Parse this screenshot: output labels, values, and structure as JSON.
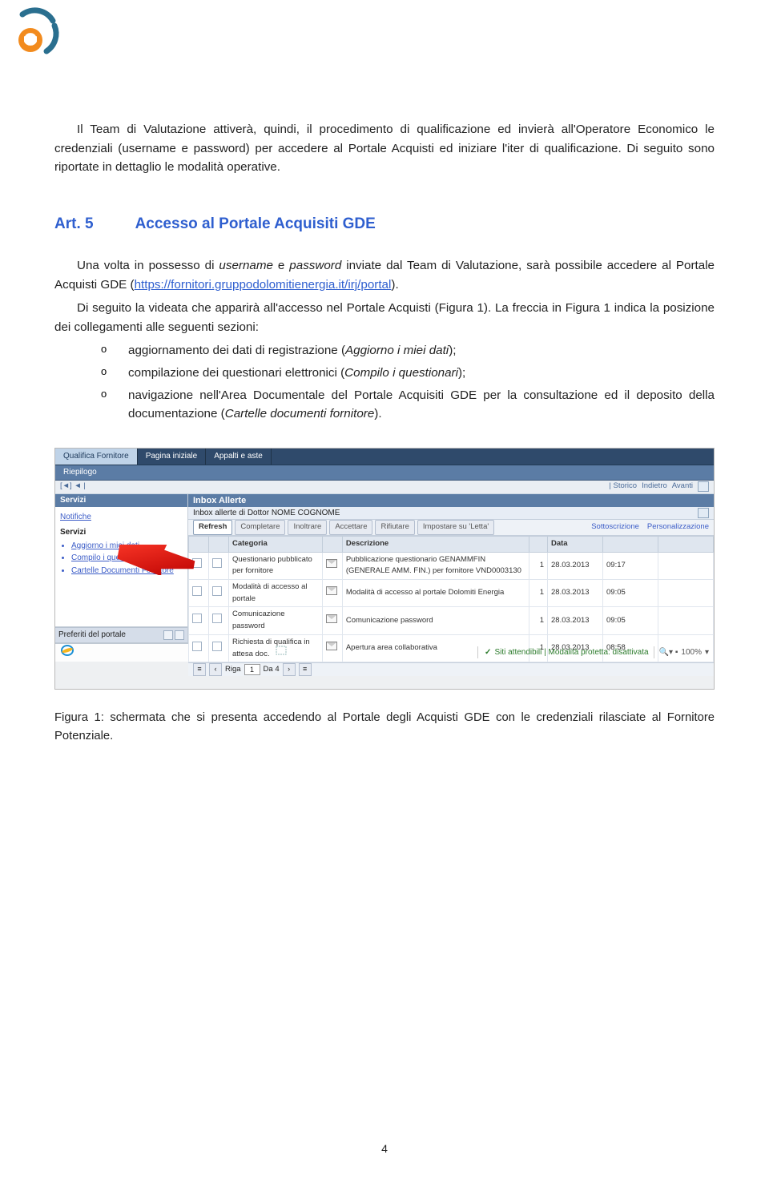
{
  "para1": "Il Team di Valutazione attiverà, quindi, il procedimento di qualificazione ed invierà all'Operatore Economico le credenziali (username e password) per accedere al Portale Acquisti ed iniziare l'iter di qualificazione. Di seguito sono riportate in dettaglio le modalità operative.",
  "article": {
    "num": "Art. 5",
    "title": "Accesso al Portale Acquisiti GDE"
  },
  "para2a": "Una volta in possesso di ",
  "para2b": "username",
  "para2c": " e ",
  "para2d": "password",
  "para2e": " inviate dal Team di Valutazione, sarà possibile accedere al Portale Acquisti GDE (",
  "link": "https://fornitori.gruppodolomitienergia.it/irj/portal",
  "para2f": ").",
  "para3": "Di seguito la videata che apparirà all'accesso nel Portale Acquisti (Figura 1). La freccia in Figura 1 indica la posizione dei collegamenti alle seguenti sezioni:",
  "bullets": [
    {
      "pre": "aggiornamento dei dati di registrazione (",
      "it": "Aggiorno i miei dati",
      "post": ");"
    },
    {
      "pre": "compilazione dei questionari elettronici (",
      "it": "Compilo i questionari",
      "post": ");"
    },
    {
      "pre": "navigazione nell'Area Documentale del Portale Acquisiti GDE per la consultazione ed il deposito della documentazione (",
      "it": "Cartelle documenti fornitore",
      "post": ")."
    }
  ],
  "shot": {
    "tabs": [
      "Qualifica Fornitore",
      "Pagina iniziale",
      "Appalti e aste"
    ],
    "riepilogo": "Riepilogo",
    "hist": {
      "left": "[◄] ◄ |",
      "items": [
        "| Storico",
        "Indietro",
        "Avanti"
      ]
    },
    "sidebar": {
      "title": "Servizi",
      "notifiche": "Notifiche",
      "servizi": "Servizi",
      "links": [
        "Aggiorno i miei dati",
        "Compilo i questionari",
        "Cartelle Documenti Fornitore"
      ],
      "pref": "Preferiti del portale"
    },
    "inbox": {
      "title": "Inbox Allerte",
      "subtitle": "Inbox allerte di Dottor NOME COGNOME",
      "buttons": [
        "Refresh",
        "Completare",
        "Inoltrare",
        "Accettare",
        "Rifiutare",
        "Impostare su 'Letta'"
      ],
      "rightlinks": [
        "Sottoscrizione",
        "Personalizzazione"
      ],
      "cols": [
        "",
        "",
        "Categoria",
        "",
        "Descrizione",
        "",
        "Data",
        "",
        ""
      ],
      "rows": [
        {
          "cat": "Questionario pubblicato per fornitore",
          "desc": "Pubblicazione questionario GENAMMFIN (GENERALE AMM. FIN.) per fornitore VND0003130",
          "n": "1",
          "date": "28.03.2013",
          "time": "09:17"
        },
        {
          "cat": "Modalità di accesso al portale",
          "desc": "Modalità di accesso al portale Dolomiti Energia",
          "n": "1",
          "date": "28.03.2013",
          "time": "09:05"
        },
        {
          "cat": "Comunicazione password",
          "desc": "Comunicazione password",
          "n": "1",
          "date": "28.03.2013",
          "time": "09:05"
        },
        {
          "cat": "Richiesta di qualifica in attesa doc.",
          "desc": "Apertura area collaborativa",
          "n": "1",
          "date": "28.03.2013",
          "time": "08:58"
        }
      ],
      "pager": {
        "label": "Riga",
        "val": "1",
        "of": "Da 4"
      }
    },
    "status": {
      "trusted": "Siti attendibili | Modalità protetta: disattivata",
      "zoom": "100%"
    }
  },
  "caption": "Figura 1: schermata che si presenta accedendo al Portale degli Acquisti GDE con le credenziali rilasciate al Fornitore Potenziale.",
  "pagenum": "4"
}
